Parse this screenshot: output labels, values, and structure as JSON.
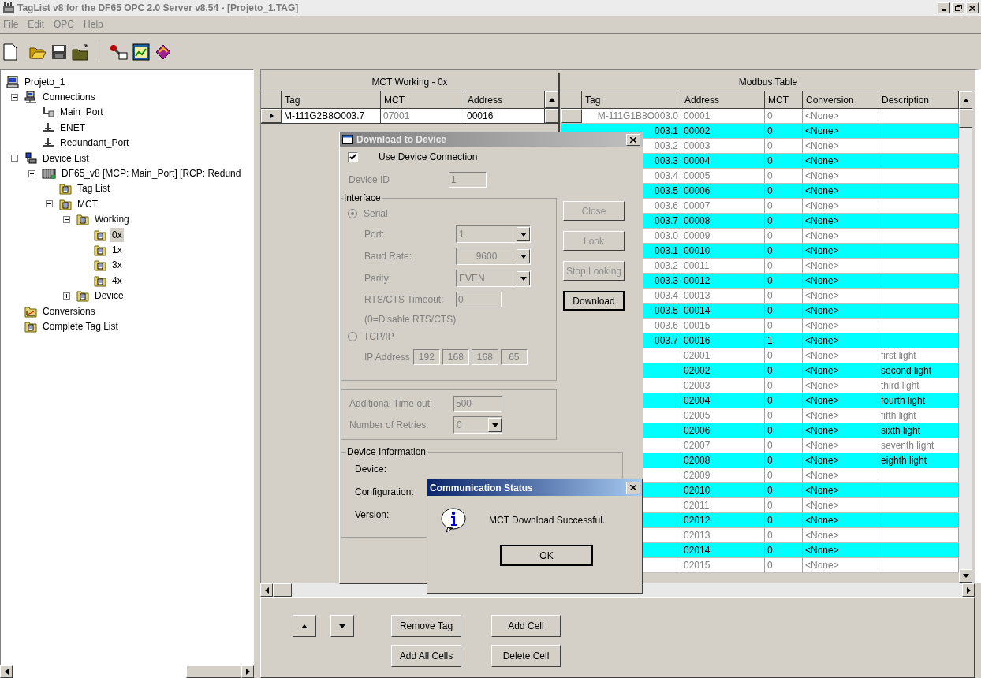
{
  "window": {
    "title": "TagList v8 for the DF65 OPC 2.0 Server v8.54 - [Projeto_1.TAG]"
  },
  "menu": [
    "File",
    "Edit",
    "OPC",
    "Help"
  ],
  "tree": [
    {
      "label": "Projeto_1",
      "kind": "project",
      "selected": false,
      "children": [
        {
          "label": "Connections",
          "kind": "connections",
          "selected": false,
          "expanded": true,
          "children": [
            {
              "label": "Main_Port",
              "kind": "port",
              "selected": false
            },
            {
              "label": "ENET",
              "kind": "network",
              "selected": false
            },
            {
              "label": "Redundant_Port",
              "kind": "network",
              "selected": false
            }
          ]
        },
        {
          "label": "Device List",
          "kind": "devices",
          "selected": false,
          "expanded": true,
          "children": [
            {
              "label": "DF65_v8 [MCP: Main_Port] [RCP: Redund",
              "kind": "rack",
              "selected": false,
              "expanded": true,
              "children": [
                {
                  "label": "Tag List",
                  "kind": "folder",
                  "selected": false
                },
                {
                  "label": "MCT",
                  "kind": "folder",
                  "selected": false,
                  "expanded": true,
                  "children": [
                    {
                      "label": "Working",
                      "kind": "folder",
                      "selected": false,
                      "expanded": true,
                      "children": [
                        {
                          "label": "0x",
                          "kind": "folder",
                          "selected": true
                        },
                        {
                          "label": "1x",
                          "kind": "folder",
                          "selected": false
                        },
                        {
                          "label": "3x",
                          "kind": "folder",
                          "selected": false
                        },
                        {
                          "label": "4x",
                          "kind": "folder",
                          "selected": false
                        }
                      ]
                    },
                    {
                      "label": "Device",
                      "kind": "folder",
                      "selected": false,
                      "expanded": false
                    }
                  ]
                }
              ]
            }
          ]
        },
        {
          "label": "Conversions",
          "kind": "conversions",
          "selected": false
        },
        {
          "label": "Complete Tag List",
          "kind": "folder",
          "selected": false
        }
      ]
    }
  ],
  "mct_table": {
    "title": "MCT Working - 0x",
    "columns": [
      {
        "label": "Tag",
        "readonly": false
      },
      {
        "label": "MCT",
        "readonly": true
      },
      {
        "label": "Address",
        "readonly": false
      }
    ],
    "rows": [
      {
        "current": true,
        "cells": [
          "M-111G2B8O003.7",
          "07001",
          "00016"
        ]
      }
    ]
  },
  "modbus_table": {
    "title": "Modbus Table",
    "columns": [
      "Tag",
      "Address",
      "MCT",
      "Conversion",
      "Description"
    ],
    "rows": [
      {
        "highlighted": false,
        "tag": "M-111G1B8O003.0",
        "address": "00001",
        "mct": "0",
        "conversion": "<None>"
      },
      {
        "highlighted": true,
        "tag": "003.1",
        "address": "00002",
        "mct": "0",
        "conversion": "<None>"
      },
      {
        "highlighted": false,
        "tag": "003.2",
        "address": "00003",
        "mct": "0",
        "conversion": "<None>"
      },
      {
        "highlighted": true,
        "tag": "003.3",
        "address": "00004",
        "mct": "0",
        "conversion": "<None>"
      },
      {
        "highlighted": false,
        "tag": "003.4",
        "address": "00005",
        "mct": "0",
        "conversion": "<None>"
      },
      {
        "highlighted": true,
        "tag": "003.5",
        "address": "00006",
        "mct": "0",
        "conversion": "<None>"
      },
      {
        "highlighted": false,
        "tag": "003.6",
        "address": "00007",
        "mct": "0",
        "conversion": "<None>"
      },
      {
        "highlighted": true,
        "tag": "003.7",
        "address": "00008",
        "mct": "0",
        "conversion": "<None>"
      },
      {
        "highlighted": false,
        "tag": "003.0",
        "address": "00009",
        "mct": "0",
        "conversion": "<None>"
      },
      {
        "highlighted": true,
        "tag": "003.1",
        "address": "00010",
        "mct": "0",
        "conversion": "<None>"
      },
      {
        "highlighted": false,
        "tag": "003.2",
        "address": "00011",
        "mct": "0",
        "conversion": "<None>"
      },
      {
        "highlighted": true,
        "tag": "003.3",
        "address": "00012",
        "mct": "0",
        "conversion": "<None>"
      },
      {
        "highlighted": false,
        "tag": "003.4",
        "address": "00013",
        "mct": "0",
        "conversion": "<None>"
      },
      {
        "highlighted": true,
        "tag": "003.5",
        "address": "00014",
        "mct": "0",
        "conversion": "<None>"
      },
      {
        "highlighted": false,
        "tag": "003.6",
        "address": "00015",
        "mct": "0",
        "conversion": "<None>"
      },
      {
        "highlighted": true,
        "tag": "003.7",
        "address": "00016",
        "mct": "1",
        "conversion": "<None>"
      },
      {
        "highlighted": false,
        "address": "02001",
        "mct": "0",
        "conversion": "<None>",
        "description": "first light"
      },
      {
        "highlighted": true,
        "address": "02002",
        "mct": "0",
        "conversion": "<None>",
        "description": "second light"
      },
      {
        "highlighted": false,
        "address": "02003",
        "mct": "0",
        "conversion": "<None>",
        "description": "third light"
      },
      {
        "highlighted": true,
        "address": "02004",
        "mct": "0",
        "conversion": "<None>",
        "description": "fourth light"
      },
      {
        "highlighted": false,
        "address": "02005",
        "mct": "0",
        "conversion": "<None>",
        "description": "fifth light"
      },
      {
        "highlighted": true,
        "address": "02006",
        "mct": "0",
        "conversion": "<None>",
        "description": "sixth light"
      },
      {
        "highlighted": false,
        "address": "02007",
        "mct": "0",
        "conversion": "<None>",
        "description": "seventh light"
      },
      {
        "highlighted": true,
        "address": "02008",
        "mct": "0",
        "conversion": "<None>",
        "description": "eighth light"
      },
      {
        "highlighted": false,
        "address": "02009",
        "mct": "0",
        "conversion": "<None>"
      },
      {
        "highlighted": true,
        "address": "02010",
        "mct": "0",
        "conversion": "<None>"
      },
      {
        "highlighted": false,
        "address": "02011",
        "mct": "0",
        "conversion": "<None>"
      },
      {
        "highlighted": true,
        "address": "02012",
        "mct": "0",
        "conversion": "<None>"
      },
      {
        "highlighted": false,
        "address": "02013",
        "mct": "0",
        "conversion": "<None>"
      },
      {
        "highlighted": true,
        "address": "02014",
        "mct": "0",
        "conversion": "<None>"
      },
      {
        "highlighted": false,
        "address": "02015",
        "mct": "0",
        "conversion": "<None>"
      }
    ]
  },
  "download_dialog": {
    "title": "Download to Device",
    "use_device_connection": {
      "label": "Use Device Connection",
      "checked": true
    },
    "device_id": {
      "label": "Device ID",
      "value": "1",
      "disabled": true
    },
    "interface": {
      "title": "Interface",
      "disabled": true,
      "options": [
        {
          "label": "Serial",
          "selected": true
        },
        {
          "label": "TCP/IP",
          "selected": false
        }
      ],
      "port": {
        "label": "Port:",
        "value": "1"
      },
      "baud_rate": {
        "label": "Baud Rate:",
        "value": "9600"
      },
      "parity": {
        "label": "Parity:",
        "value": "EVEN"
      },
      "rts_timeout": {
        "label": "RTS/CTS Timeout:",
        "value": "0"
      },
      "rts_note": "(0=Disable RTS/CTS)",
      "ip": {
        "label": "IP Address",
        "parts": [
          "192",
          "168",
          "168",
          "65"
        ]
      }
    },
    "buttons": [
      {
        "label": "Close",
        "disabled": true
      },
      {
        "label": "Look",
        "disabled": true
      },
      {
        "label": "Stop Looking",
        "disabled": true
      },
      {
        "label": "Download",
        "disabled": false
      }
    ],
    "timeout": {
      "label": "Additional Time out:",
      "value": "500",
      "disabled": true
    },
    "retries": {
      "label": "Number of Retries:",
      "value": "0",
      "disabled": true
    },
    "device_info": {
      "title": "Device Information",
      "labels": [
        "Device:",
        "Configuration:",
        "Version:"
      ]
    }
  },
  "status_dialog": {
    "title": "Communication Status",
    "message": "MCT Download Successful.",
    "button": "OK"
  },
  "bottom_buttons": [
    "Remove Tag",
    "Add Cell",
    "Add All Cells",
    "Delete Cell"
  ]
}
